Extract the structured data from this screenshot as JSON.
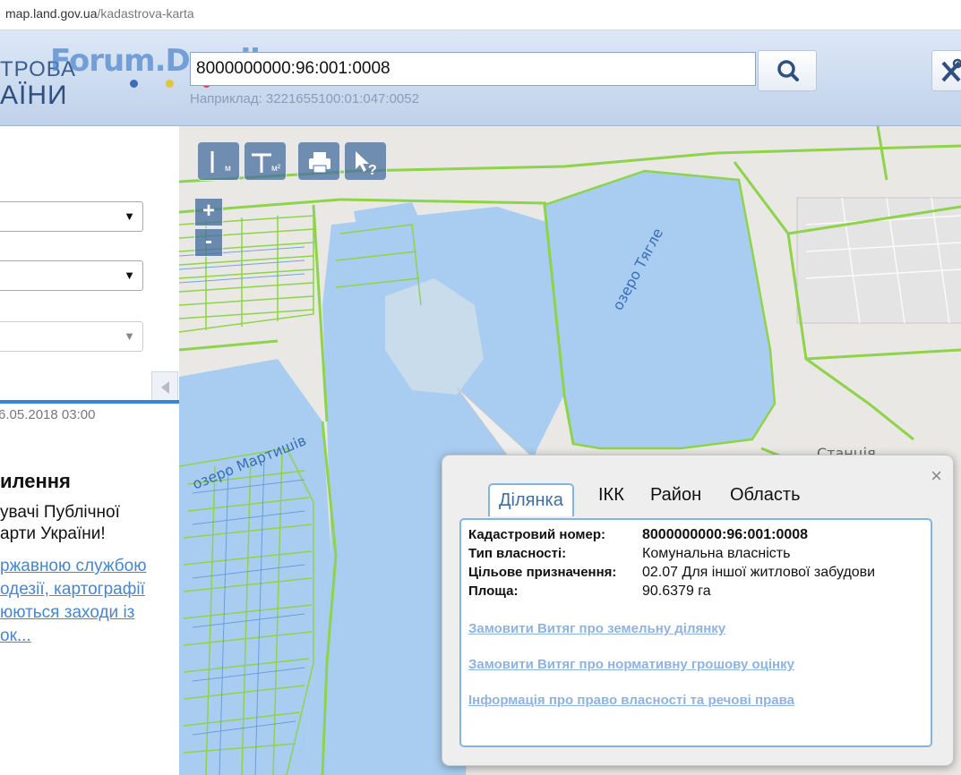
{
  "browser": {
    "url_host": "map.land.gov.ua",
    "url_path": "/kadastrova-karta"
  },
  "header": {
    "logo_line1": "ТРОВА",
    "logo_line2": "АЇНИ",
    "watermark": "Forum.Domik.ua",
    "search_value": "8000000000:96:001:0008",
    "search_hint": "Наприклад: 3221655100:01:047:0052"
  },
  "sidebar": {
    "date": "6.05.2018 03:00",
    "news_title": "илення",
    "news_text": [
      "увачі Публічної",
      "арти України!"
    ],
    "news_link": [
      "ржавною службою",
      "одезії, картографії",
      "юються заходи із",
      "ок..."
    ]
  },
  "map": {
    "toolbar": [
      "measure-length",
      "measure-area",
      "print",
      "identify"
    ],
    "zoom_in": "+",
    "zoom_out": "-",
    "labels": {
      "lake_tyahle": "озеро Тягле",
      "lake_martyshiv": "озеро Мартишів",
      "station": "Станція"
    }
  },
  "popup": {
    "tabs": [
      "Ділянка",
      "ІКК",
      "Район",
      "Область"
    ],
    "active_tab": "Ділянка",
    "fields": [
      {
        "label": "Кадастровий номер:",
        "value": "8000000000:96:001:0008"
      },
      {
        "label": "Тип власності:",
        "value": "Комунальна власність"
      },
      {
        "label": "Цільове призначення:",
        "value": "02.07 Для іншої житлової забудови"
      },
      {
        "label": "Площа:",
        "value": "90.6379 га"
      }
    ],
    "links": [
      "Замовити Витяг про земельну ділянку",
      "Замовити Витяг про нормативну грошову оцінку",
      "Інформація про право власності та речові права"
    ],
    "close": "×"
  },
  "colors": {
    "parcel_border": "#8ed34a",
    "water": "#a9cdf0",
    "link": "#4a86c8",
    "accent": "#3f82cf"
  }
}
